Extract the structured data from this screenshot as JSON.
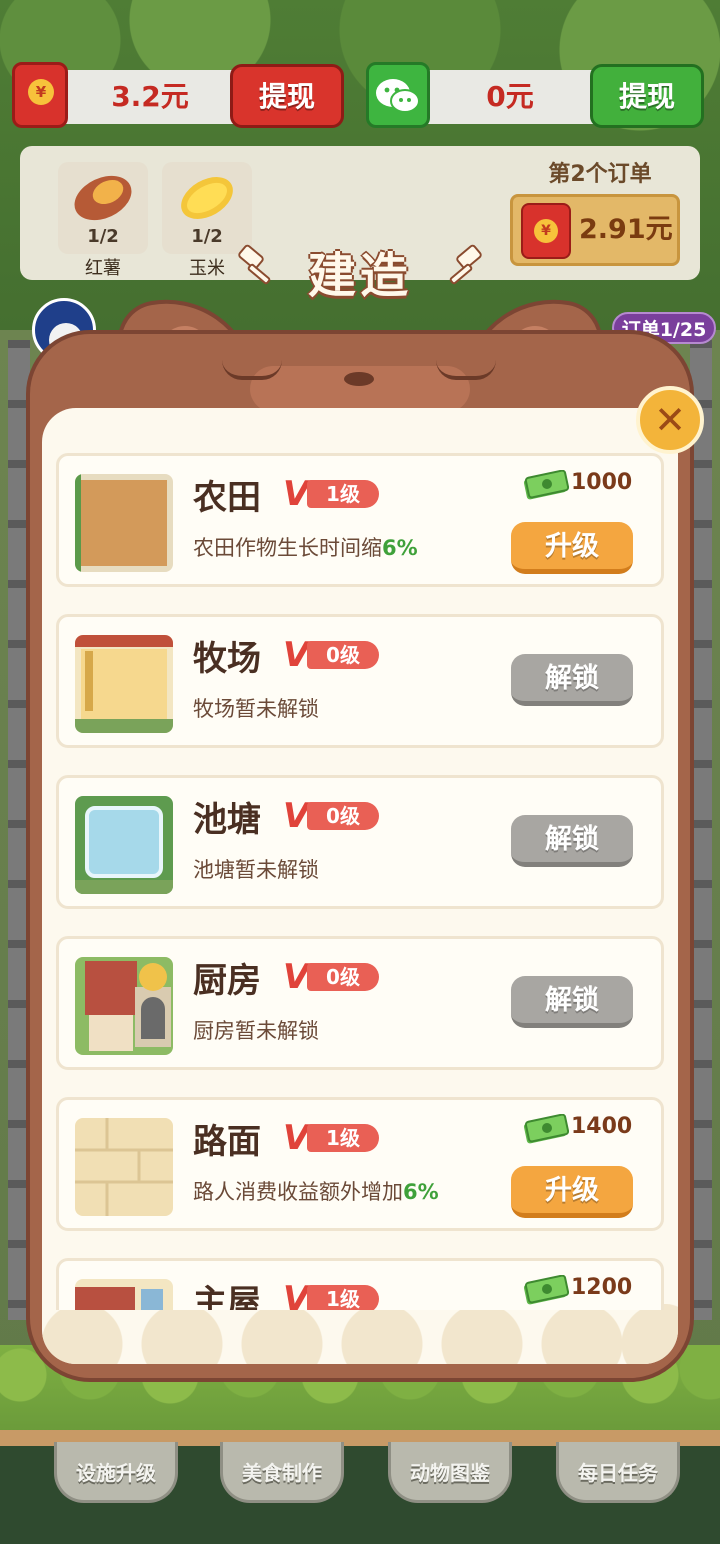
{
  "currency": {
    "redpacket_amount": "3.2元",
    "wechat_amount": "0元",
    "withdraw_label": "提现",
    "redpacket_symbol": "¥"
  },
  "order": {
    "items": [
      {
        "name": "红薯",
        "count": "1/2"
      },
      {
        "name": "玉米",
        "count": "1/2"
      }
    ],
    "title": "第2个订单",
    "reward": "2.91元",
    "progress": "订单1/25"
  },
  "modal": {
    "title": "建造",
    "close_symbol": "✕",
    "level_prefix": "V",
    "rows": [
      {
        "name": "农田",
        "level": "1级",
        "desc": "农田作物生长时间缩",
        "pct": "6%",
        "cost": "1000",
        "action": "升级",
        "state": "upgrade"
      },
      {
        "name": "牧场",
        "level": "0级",
        "desc": "牧场暂未解锁",
        "pct": "",
        "cost": "",
        "action": "解锁",
        "state": "locked"
      },
      {
        "name": "池塘",
        "level": "0级",
        "desc": "池塘暂未解锁",
        "pct": "",
        "cost": "",
        "action": "解锁",
        "state": "locked"
      },
      {
        "name": "厨房",
        "level": "0级",
        "desc": "厨房暂未解锁",
        "pct": "",
        "cost": "",
        "action": "解锁",
        "state": "locked"
      },
      {
        "name": "路面",
        "level": "1级",
        "desc": "路人消费收益额外增加",
        "pct": "6%",
        "cost": "1400",
        "action": "升级",
        "state": "upgrade"
      },
      {
        "name": "主屋",
        "level": "1级",
        "desc": "",
        "pct": "",
        "cost": "1200",
        "action": "",
        "state": "upgrade"
      }
    ]
  },
  "bottom_nav": [
    "设施升级",
    "美食制作",
    "动物图鉴",
    "每日任务"
  ],
  "colors": {
    "redpacket": "#d8322c",
    "wechat": "#3eb540",
    "modal_frame": "#a4654a",
    "upgrade_button": "#f4a640",
    "unlock_button": "#a8a6a2",
    "level_pill": "#e96055"
  }
}
